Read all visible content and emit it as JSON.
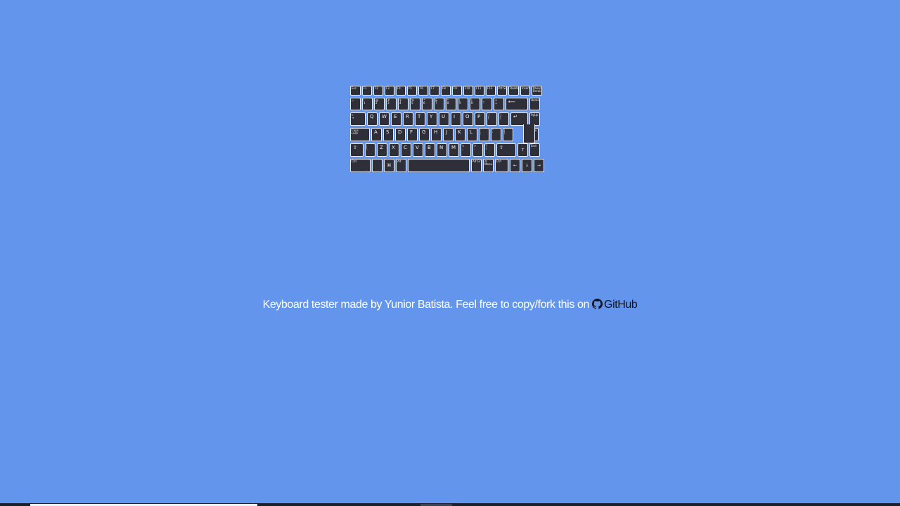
{
  "page": {
    "background_color": "#6495ed"
  },
  "keyboard": {
    "rows": [
      {
        "height": 14,
        "keys": [
          {
            "id": "esc",
            "label": "Esc",
            "w": 15,
            "size": "tiny"
          },
          {
            "id": "f1",
            "label": "F1",
            "w": 14,
            "size": "tiny"
          },
          {
            "id": "f2",
            "label": "F2",
            "w": 14,
            "size": "tiny"
          },
          {
            "id": "f3",
            "label": "F3",
            "w": 14,
            "size": "tiny"
          },
          {
            "id": "f4",
            "label": "F4",
            "w": 14,
            "size": "tiny"
          },
          {
            "id": "f5",
            "label": "F5",
            "w": 14,
            "size": "tiny"
          },
          {
            "id": "f6",
            "label": "F6",
            "w": 14,
            "size": "tiny"
          },
          {
            "id": "f7",
            "label": "F7",
            "w": 14,
            "size": "tiny"
          },
          {
            "id": "f8",
            "label": "F8",
            "w": 14,
            "size": "tiny"
          },
          {
            "id": "f9",
            "label": "F9",
            "w": 14,
            "size": "tiny"
          },
          {
            "id": "f10",
            "label": "F10",
            "w": 14,
            "size": "tiny"
          },
          {
            "id": "f11",
            "label": "F11",
            "w": 14,
            "size": "tiny"
          },
          {
            "id": "f12",
            "label": "F12",
            "w": 14,
            "size": "tiny"
          },
          {
            "id": "prtsc",
            "label": "Prt Sc",
            "w": 14,
            "size": "tiny"
          },
          {
            "id": "delete",
            "label": "Delete",
            "w": 15,
            "size": "tiny"
          },
          {
            "id": "insert",
            "label": "Insert",
            "w": 14,
            "size": "tiny"
          },
          {
            "id": "pause",
            "label": "Pause\nBreak",
            "w": 15,
            "size": "tiny"
          }
        ]
      },
      {
        "height": 18,
        "keys": [
          {
            "id": "backtick",
            "label": "~\n`",
            "w": 15,
            "size": "tiny"
          },
          {
            "id": "digit1",
            "label": "!\n1",
            "w": 15,
            "size": "tiny"
          },
          {
            "id": "digit2",
            "label": "@\n2",
            "w": 15,
            "size": "tiny"
          },
          {
            "id": "digit3",
            "label": "#\n3",
            "w": 15,
            "size": "tiny"
          },
          {
            "id": "digit4",
            "label": "$\n4",
            "w": 15,
            "size": "tiny"
          },
          {
            "id": "digit5",
            "label": "%\n5",
            "w": 15,
            "size": "tiny"
          },
          {
            "id": "digit6",
            "label": "^\n6",
            "w": 15,
            "size": "tiny"
          },
          {
            "id": "digit7",
            "label": "&\n7",
            "w": 15,
            "size": "tiny"
          },
          {
            "id": "digit8",
            "label": "*\n8",
            "w": 15,
            "size": "tiny"
          },
          {
            "id": "digit9",
            "label": "(\n9",
            "w": 15,
            "size": "tiny"
          },
          {
            "id": "digit0",
            "label": ")\n0",
            "w": 15,
            "size": "tiny"
          },
          {
            "id": "minus",
            "label": "_\n-",
            "w": 15,
            "size": "tiny"
          },
          {
            "id": "equal",
            "label": "+\n=",
            "w": 15,
            "size": "tiny"
          },
          {
            "id": "backspace",
            "label": "⟵",
            "w": 32,
            "size": "big"
          },
          {
            "id": "home",
            "label": "Home",
            "w": 15,
            "size": "tiny"
          }
        ]
      },
      {
        "height": 19,
        "keys": [
          {
            "id": "tab",
            "label": "⇤\n⇥",
            "w": 22,
            "size": "tiny"
          },
          {
            "id": "q",
            "label": "Q",
            "w": 15,
            "size": "big"
          },
          {
            "id": "w",
            "label": "W",
            "w": 15,
            "size": "big"
          },
          {
            "id": "e",
            "label": "E",
            "w": 15,
            "size": "big"
          },
          {
            "id": "r",
            "label": "R",
            "w": 15,
            "size": "big"
          },
          {
            "id": "t",
            "label": "T",
            "w": 15,
            "size": "big"
          },
          {
            "id": "y",
            "label": "Y",
            "w": 15,
            "size": "big"
          },
          {
            "id": "u",
            "label": "U",
            "w": 15,
            "size": "big"
          },
          {
            "id": "i",
            "label": "I",
            "w": 15,
            "size": "big"
          },
          {
            "id": "o",
            "label": "O",
            "w": 15,
            "size": "big"
          },
          {
            "id": "p",
            "label": "P",
            "w": 15,
            "size": "big"
          },
          {
            "id": "bracketleft",
            "label": "{\n[",
            "w": 15,
            "size": "tiny"
          },
          {
            "id": "bracketright",
            "label": "}\n]",
            "w": 15,
            "size": "tiny"
          },
          {
            "id": "enter",
            "label": "↵",
            "w": 25,
            "size": "big"
          },
          {
            "id": "pgup",
            "label": "PgUp",
            "w": 15,
            "size": "tiny"
          }
        ]
      },
      {
        "height": 19,
        "keys": [
          {
            "id": "capslock",
            "label": "Caps\nLock",
            "w": 28,
            "size": "tiny"
          },
          {
            "id": "a",
            "label": "A",
            "w": 15,
            "size": "big"
          },
          {
            "id": "s",
            "label": "S",
            "w": 15,
            "size": "big"
          },
          {
            "id": "d",
            "label": "D",
            "w": 15,
            "size": "big"
          },
          {
            "id": "f",
            "label": "F",
            "w": 15,
            "size": "big"
          },
          {
            "id": "g",
            "label": "G",
            "w": 15,
            "size": "big"
          },
          {
            "id": "h",
            "label": "H",
            "w": 15,
            "size": "big"
          },
          {
            "id": "j",
            "label": "J",
            "w": 15,
            "size": "big"
          },
          {
            "id": "k",
            "label": "K",
            "w": 15,
            "size": "big"
          },
          {
            "id": "l",
            "label": "L",
            "w": 15,
            "size": "big"
          },
          {
            "id": "semicolon",
            "label": ":\n;",
            "w": 15,
            "size": "tiny"
          },
          {
            "id": "quote",
            "label": "\"\n'",
            "w": 15,
            "size": "tiny"
          },
          {
            "id": "backslash",
            "label": "|\n\\",
            "w": 15,
            "size": "tiny"
          },
          {
            "id": "enter-spacer",
            "label": "",
            "w": 17,
            "size": "none"
          },
          {
            "id": "pgdn",
            "label": "PgDn",
            "w": 15,
            "size": "tiny"
          }
        ]
      },
      {
        "height": 19,
        "keys": [
          {
            "id": "shiftleft",
            "label": "⇧",
            "w": 19,
            "size": "big"
          },
          {
            "id": "intlbackslash",
            "label": "|\n\\",
            "w": 15,
            "size": "tiny"
          },
          {
            "id": "z",
            "label": "Z",
            "w": 15,
            "size": "big"
          },
          {
            "id": "x",
            "label": "X",
            "w": 15,
            "size": "big"
          },
          {
            "id": "c",
            "label": "C",
            "w": 15,
            "size": "big"
          },
          {
            "id": "v",
            "label": "V",
            "w": 15,
            "size": "big"
          },
          {
            "id": "b",
            "label": "B",
            "w": 15,
            "size": "big"
          },
          {
            "id": "n",
            "label": "N",
            "w": 15,
            "size": "big"
          },
          {
            "id": "m",
            "label": "M",
            "w": 15,
            "size": "big"
          },
          {
            "id": "comma",
            "label": "<\n,",
            "w": 15,
            "size": "tiny"
          },
          {
            "id": "period",
            "label": ">\n.",
            "w": 15,
            "size": "tiny"
          },
          {
            "id": "slash",
            "label": "?\n/",
            "w": 15,
            "size": "tiny"
          },
          {
            "id": "shiftright",
            "label": "⇧",
            "w": 28,
            "size": "big"
          },
          {
            "id": "arrowup",
            "label": "↑",
            "w": 15,
            "size": "center"
          },
          {
            "id": "end",
            "label": "End",
            "w": 15,
            "size": "tiny"
          }
        ]
      },
      {
        "height": 19,
        "keys": [
          {
            "id": "ctrlleft",
            "label": "Ctrl",
            "w": 29,
            "size": "tiny"
          },
          {
            "id": "fn",
            "label": "",
            "w": 15,
            "size": "tiny"
          },
          {
            "id": "meta",
            "label": "⌘",
            "w": 15,
            "size": "center"
          },
          {
            "id": "altleft",
            "label": "Alt",
            "w": 15,
            "size": "tiny"
          },
          {
            "id": "space",
            "label": "",
            "w": 88,
            "size": "none"
          },
          {
            "id": "altgr",
            "label": "Alt Gr",
            "w": 15,
            "size": "tiny"
          },
          {
            "id": "contextmenu",
            "label": "☰\nMenu",
            "w": 15,
            "size": "topcenter"
          },
          {
            "id": "ctrlright",
            "label": "Ctrl",
            "w": 19,
            "size": "tiny"
          },
          {
            "id": "arrowleft",
            "label": "←",
            "w": 15,
            "size": "center"
          },
          {
            "id": "arrowdown",
            "label": "↓",
            "w": 15,
            "size": "center"
          },
          {
            "id": "arrowright",
            "label": "→",
            "w": 15,
            "size": "center"
          }
        ]
      }
    ]
  },
  "footer": {
    "text": "Keyboard tester made by Yunior Batista. Feel free to copy/fork this on ",
    "link_label": "GitHub",
    "link_icon": "github-icon"
  },
  "bottom_bar": {
    "color": "#1b1f2e",
    "highlight_color": "#eef1f8"
  }
}
